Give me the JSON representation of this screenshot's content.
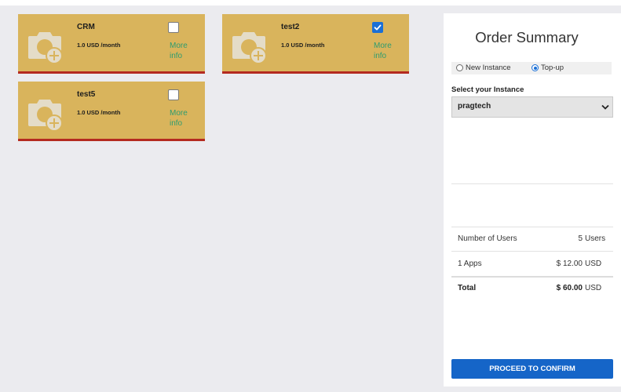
{
  "products": [
    {
      "name": "CRM",
      "price": "1.0 USD /month",
      "more_info": "More info",
      "checked": false
    },
    {
      "name": "test2",
      "price": "1.0 USD /month",
      "more_info": "More info",
      "checked": true
    },
    {
      "name": "test5",
      "price": "1.0 USD /month",
      "more_info": "More info",
      "checked": false
    }
  ],
  "summary": {
    "title": "Order Summary",
    "radio_new": "New Instance",
    "radio_topup": "Top-up",
    "selected_radio": "Top-up",
    "select_label": "Select your Instance",
    "select_value": "pragtech",
    "rows": [
      {
        "label": "Number of Users",
        "value": "5",
        "unit": "Users"
      },
      {
        "label": "1 Apps",
        "value": "$ 12.00",
        "unit": "USD"
      }
    ],
    "total": {
      "label": "Total",
      "value": "$ 60.00",
      "unit": "USD"
    },
    "cta": "PROCEED TO CONFIRM"
  },
  "colors": {
    "card": "#d9b45c",
    "card_border": "#b42a20",
    "link": "#2e9c6f",
    "accent": "#1565c8"
  }
}
